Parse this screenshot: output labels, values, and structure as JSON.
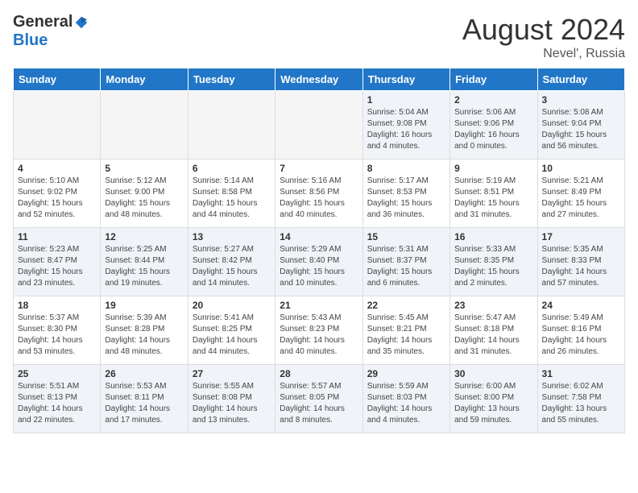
{
  "header": {
    "logo_general": "General",
    "logo_blue": "Blue",
    "month_year": "August 2024",
    "location": "Nevel', Russia"
  },
  "days_of_week": [
    "Sunday",
    "Monday",
    "Tuesday",
    "Wednesday",
    "Thursday",
    "Friday",
    "Saturday"
  ],
  "weeks": [
    [
      {
        "day": "",
        "content": ""
      },
      {
        "day": "",
        "content": ""
      },
      {
        "day": "",
        "content": ""
      },
      {
        "day": "",
        "content": ""
      },
      {
        "day": "1",
        "content": "Sunrise: 5:04 AM\nSunset: 9:08 PM\nDaylight: 16 hours\nand 4 minutes."
      },
      {
        "day": "2",
        "content": "Sunrise: 5:06 AM\nSunset: 9:06 PM\nDaylight: 16 hours\nand 0 minutes."
      },
      {
        "day": "3",
        "content": "Sunrise: 5:08 AM\nSunset: 9:04 PM\nDaylight: 15 hours\nand 56 minutes."
      }
    ],
    [
      {
        "day": "4",
        "content": "Sunrise: 5:10 AM\nSunset: 9:02 PM\nDaylight: 15 hours\nand 52 minutes."
      },
      {
        "day": "5",
        "content": "Sunrise: 5:12 AM\nSunset: 9:00 PM\nDaylight: 15 hours\nand 48 minutes."
      },
      {
        "day": "6",
        "content": "Sunrise: 5:14 AM\nSunset: 8:58 PM\nDaylight: 15 hours\nand 44 minutes."
      },
      {
        "day": "7",
        "content": "Sunrise: 5:16 AM\nSunset: 8:56 PM\nDaylight: 15 hours\nand 40 minutes."
      },
      {
        "day": "8",
        "content": "Sunrise: 5:17 AM\nSunset: 8:53 PM\nDaylight: 15 hours\nand 36 minutes."
      },
      {
        "day": "9",
        "content": "Sunrise: 5:19 AM\nSunset: 8:51 PM\nDaylight: 15 hours\nand 31 minutes."
      },
      {
        "day": "10",
        "content": "Sunrise: 5:21 AM\nSunset: 8:49 PM\nDaylight: 15 hours\nand 27 minutes."
      }
    ],
    [
      {
        "day": "11",
        "content": "Sunrise: 5:23 AM\nSunset: 8:47 PM\nDaylight: 15 hours\nand 23 minutes."
      },
      {
        "day": "12",
        "content": "Sunrise: 5:25 AM\nSunset: 8:44 PM\nDaylight: 15 hours\nand 19 minutes."
      },
      {
        "day": "13",
        "content": "Sunrise: 5:27 AM\nSunset: 8:42 PM\nDaylight: 15 hours\nand 14 minutes."
      },
      {
        "day": "14",
        "content": "Sunrise: 5:29 AM\nSunset: 8:40 PM\nDaylight: 15 hours\nand 10 minutes."
      },
      {
        "day": "15",
        "content": "Sunrise: 5:31 AM\nSunset: 8:37 PM\nDaylight: 15 hours\nand 6 minutes."
      },
      {
        "day": "16",
        "content": "Sunrise: 5:33 AM\nSunset: 8:35 PM\nDaylight: 15 hours\nand 2 minutes."
      },
      {
        "day": "17",
        "content": "Sunrise: 5:35 AM\nSunset: 8:33 PM\nDaylight: 14 hours\nand 57 minutes."
      }
    ],
    [
      {
        "day": "18",
        "content": "Sunrise: 5:37 AM\nSunset: 8:30 PM\nDaylight: 14 hours\nand 53 minutes."
      },
      {
        "day": "19",
        "content": "Sunrise: 5:39 AM\nSunset: 8:28 PM\nDaylight: 14 hours\nand 48 minutes."
      },
      {
        "day": "20",
        "content": "Sunrise: 5:41 AM\nSunset: 8:25 PM\nDaylight: 14 hours\nand 44 minutes."
      },
      {
        "day": "21",
        "content": "Sunrise: 5:43 AM\nSunset: 8:23 PM\nDaylight: 14 hours\nand 40 minutes."
      },
      {
        "day": "22",
        "content": "Sunrise: 5:45 AM\nSunset: 8:21 PM\nDaylight: 14 hours\nand 35 minutes."
      },
      {
        "day": "23",
        "content": "Sunrise: 5:47 AM\nSunset: 8:18 PM\nDaylight: 14 hours\nand 31 minutes."
      },
      {
        "day": "24",
        "content": "Sunrise: 5:49 AM\nSunset: 8:16 PM\nDaylight: 14 hours\nand 26 minutes."
      }
    ],
    [
      {
        "day": "25",
        "content": "Sunrise: 5:51 AM\nSunset: 8:13 PM\nDaylight: 14 hours\nand 22 minutes."
      },
      {
        "day": "26",
        "content": "Sunrise: 5:53 AM\nSunset: 8:11 PM\nDaylight: 14 hours\nand 17 minutes."
      },
      {
        "day": "27",
        "content": "Sunrise: 5:55 AM\nSunset: 8:08 PM\nDaylight: 14 hours\nand 13 minutes."
      },
      {
        "day": "28",
        "content": "Sunrise: 5:57 AM\nSunset: 8:05 PM\nDaylight: 14 hours\nand 8 minutes."
      },
      {
        "day": "29",
        "content": "Sunrise: 5:59 AM\nSunset: 8:03 PM\nDaylight: 14 hours\nand 4 minutes."
      },
      {
        "day": "30",
        "content": "Sunrise: 6:00 AM\nSunset: 8:00 PM\nDaylight: 13 hours\nand 59 minutes."
      },
      {
        "day": "31",
        "content": "Sunrise: 6:02 AM\nSunset: 7:58 PM\nDaylight: 13 hours\nand 55 minutes."
      }
    ]
  ]
}
